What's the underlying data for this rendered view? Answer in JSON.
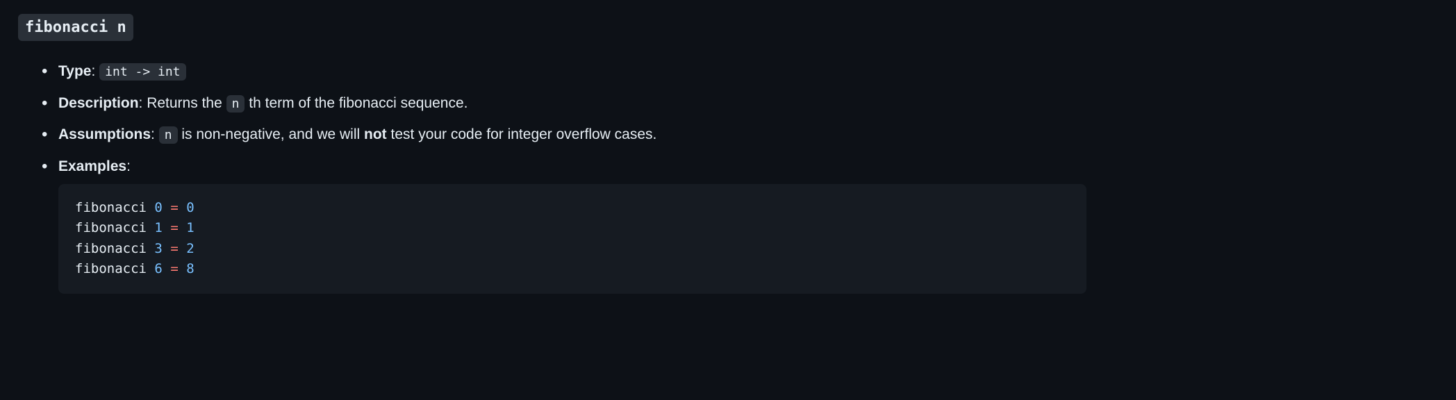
{
  "signature": "fibonacci n",
  "items": {
    "type": {
      "label": "Type",
      "value": "int -> int"
    },
    "description": {
      "label": "Description",
      "prefix": "Returns the ",
      "param": "n",
      "suffix": " th term of the fibonacci sequence."
    },
    "assumptions": {
      "label": "Assumptions",
      "param": "n",
      "text1": " is non-negative, and we will ",
      "emph": "not",
      "text2": " test your code for integer overflow cases."
    },
    "examples": {
      "label": "Examples",
      "lines": [
        {
          "fn": "fibonacci",
          "arg": "0",
          "eq": "=",
          "res": "0"
        },
        {
          "fn": "fibonacci",
          "arg": "1",
          "eq": "=",
          "res": "1"
        },
        {
          "fn": "fibonacci",
          "arg": "3",
          "eq": "=",
          "res": "2"
        },
        {
          "fn": "fibonacci",
          "arg": "6",
          "eq": "=",
          "res": "8"
        }
      ]
    }
  }
}
